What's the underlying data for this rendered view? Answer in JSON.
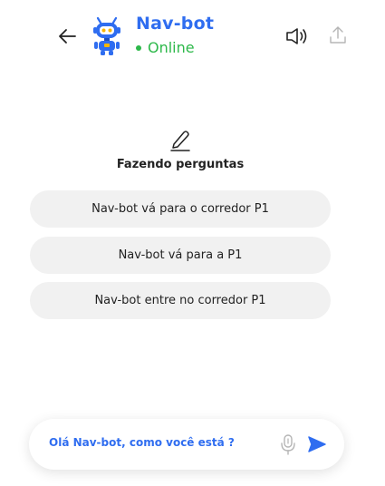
{
  "header": {
    "bot_name": "Nav-bot",
    "status": "Online",
    "icons": {
      "back": "arrow-left-icon",
      "avatar": "robot-icon",
      "speaker": "speaker-icon",
      "upload": "upload-icon"
    }
  },
  "suggestions": {
    "icon": "pencil-icon",
    "title": "Fazendo perguntas",
    "items": [
      {
        "label": "Nav-bot vá para o corredor P1"
      },
      {
        "label": "Nav-bot vá para a P1"
      },
      {
        "label": "Nav-bot entre no corredor P1"
      }
    ]
  },
  "input": {
    "value": "Olá Nav-bot, como você está ?",
    "mic_icon": "microphone-icon",
    "send_icon": "send-icon"
  },
  "colors": {
    "accent": "#2f6df0",
    "online": "#2db84a",
    "chip_background": "#f1f1f1"
  }
}
